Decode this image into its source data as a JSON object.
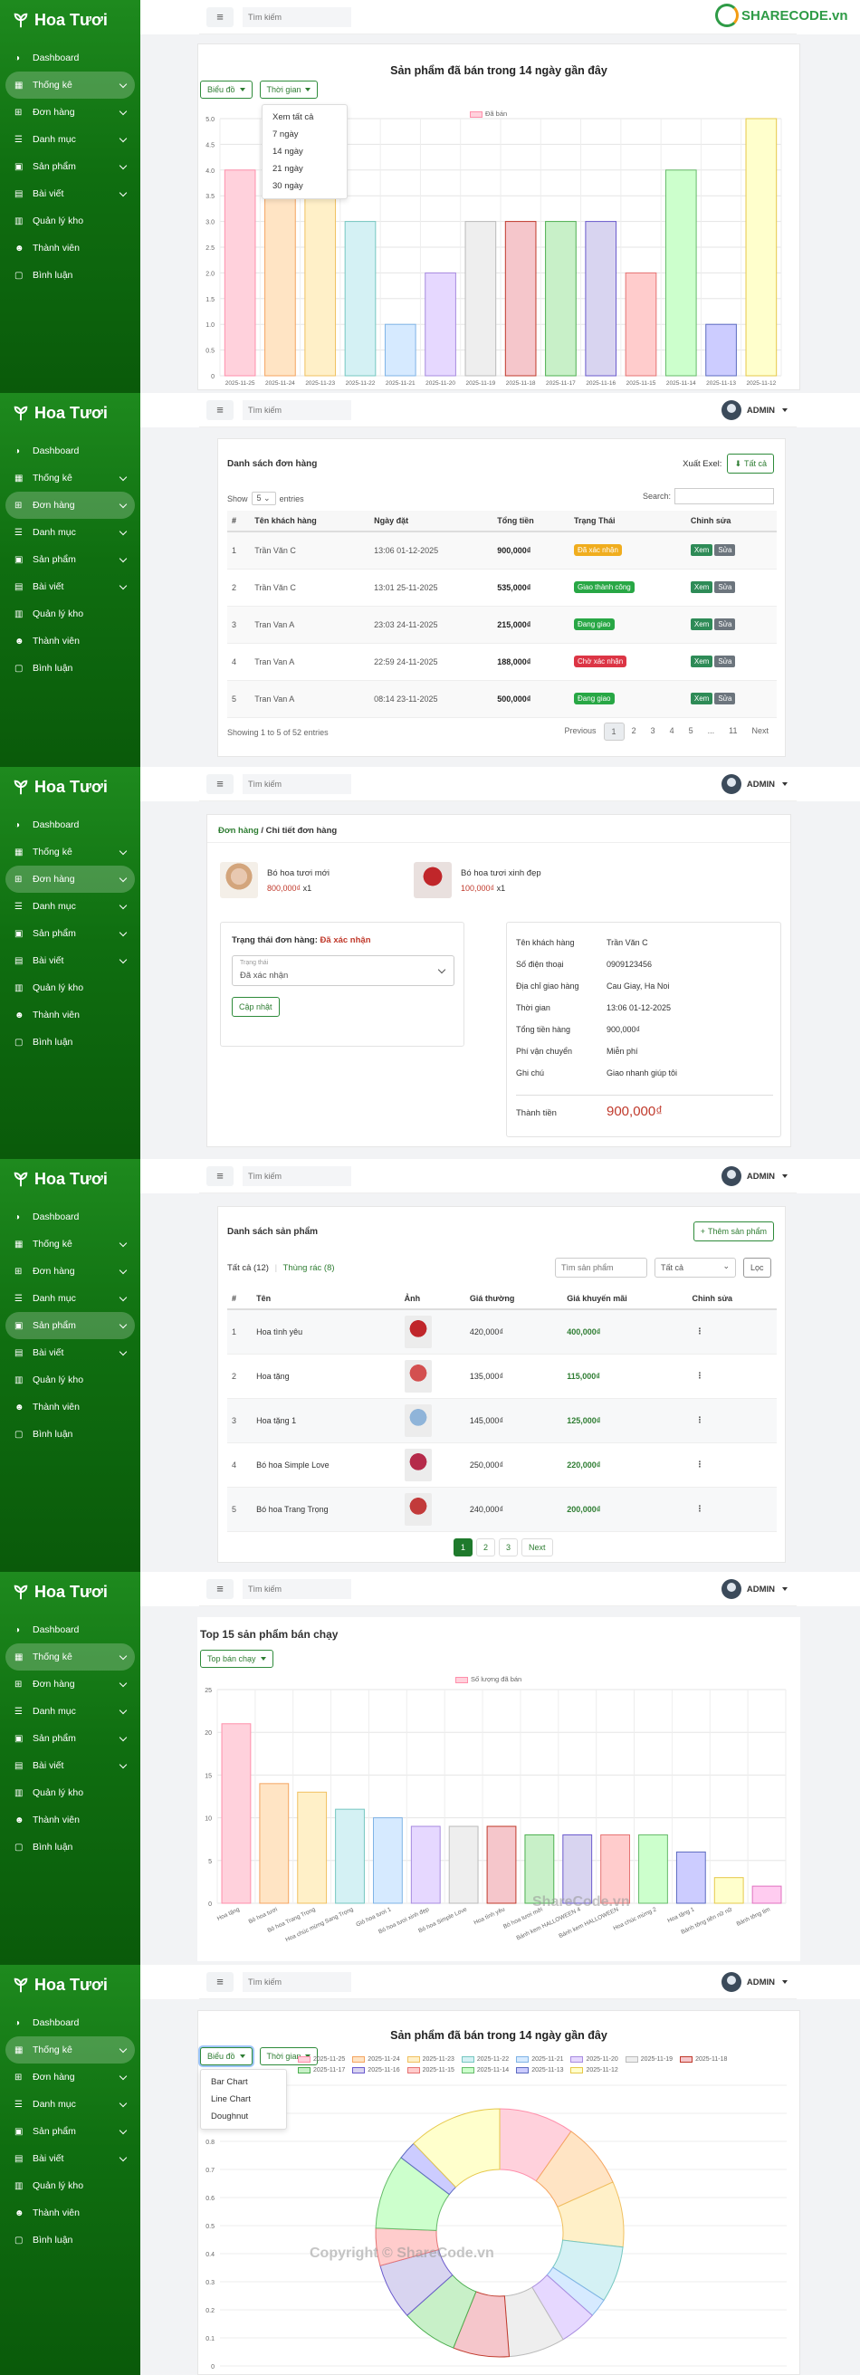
{
  "brand": "Hoa Tươi",
  "nav": [
    "Dashboard",
    "Thống kê",
    "Đơn hàng",
    "Danh mục",
    "Sản phẩm",
    "Bài viết",
    "Quản lý kho",
    "Thành viên",
    "Bình luận"
  ],
  "search_placeholder": "Tìm kiếm",
  "admin_label": "ADMIN",
  "sharecode_logo": "SHARECODE.vn",
  "watermark1": "ShareCode.vn",
  "watermark2": "Copyright © ShareCode.vn",
  "panel1": {
    "title": "Sản phẩm đã bán trong 14 ngày gần đây",
    "btn_chart": "Biểu đồ",
    "btn_time": "Thời gian",
    "time_options": [
      "Xem tất cả",
      "7 ngày",
      "14 ngày",
      "21 ngày",
      "30 ngày"
    ],
    "legend": "Đã bán"
  },
  "panel2": {
    "card_title": "Danh sách đơn hàng",
    "export_label": "Xuất Exel:",
    "export_btn": "Tất cả",
    "show_label": "Show",
    "show_value": "5",
    "entries_label": "entries",
    "search_label": "Search:",
    "columns": [
      "#",
      "Tên khách hàng",
      "Ngày đặt",
      "Tổng tiền",
      "Trạng Thái",
      "Chỉnh sửa"
    ],
    "rows": [
      {
        "id": "1",
        "name": "Trần Văn C",
        "date": "13:06 01-12-2025",
        "total": "900,000₫",
        "status": "Đã xác nhận",
        "color": "#f0ad1e"
      },
      {
        "id": "2",
        "name": "Trần Văn C",
        "date": "13:01 25-11-2025",
        "total": "535,000₫",
        "status": "Giao thành công",
        "color": "#28a745"
      },
      {
        "id": "3",
        "name": "Tran Van A",
        "date": "23:03 24-11-2025",
        "total": "215,000₫",
        "status": "Đang giao",
        "color": "#28a745"
      },
      {
        "id": "4",
        "name": "Tran Van A",
        "date": "22:59 24-11-2025",
        "total": "188,000₫",
        "status": "Chờ xác nhận",
        "color": "#dc3545"
      },
      {
        "id": "5",
        "name": "Tran Van A",
        "date": "08:14 23-11-2025",
        "total": "500,000₫",
        "status": "Đang giao",
        "color": "#28a745"
      }
    ],
    "btn_view": "Xem",
    "btn_edit": "Sửa",
    "info": "Showing 1 to 5 of 52 entries",
    "pages": [
      "Previous",
      "1",
      "2",
      "3",
      "4",
      "5",
      "...",
      "11",
      "Next"
    ]
  },
  "panel3": {
    "crumb_parent": "Đơn hàng",
    "crumb_current": "/ Chi tiết đơn hàng",
    "items": [
      {
        "name": "Bó hoa tươi mới",
        "price": "800,000₫",
        "qty": "x1"
      },
      {
        "name": "Bó hoa tươi xinh đẹp",
        "price": "100,000₫",
        "qty": "x1"
      }
    ],
    "status_label": "Trạng thái đơn hàng:",
    "status_value": "Đã xác nhận",
    "select_label": "Trạng thái",
    "select_value": "Đã xác nhận",
    "update_btn": "Cập nhật",
    "info": [
      {
        "k": "Tên khách hàng",
        "v": "Trần Văn C"
      },
      {
        "k": "Số điện thoại",
        "v": "0909123456"
      },
      {
        "k": "Địa chỉ giao hàng",
        "v": "Cau Giay, Ha Noi"
      },
      {
        "k": "Thời gian",
        "v": "13:06 01-12-2025"
      },
      {
        "k": "Tổng tiền hàng",
        "v": "900,000₫"
      },
      {
        "k": "Phí vận chuyển",
        "v": "Miễn phí"
      },
      {
        "k": "Ghi chú",
        "v": "Giao nhanh giúp tôi"
      }
    ],
    "total_label": "Thành tiền",
    "total_value": "900,000₫"
  },
  "panel4": {
    "card_title": "Danh sách sản phẩm",
    "add_btn": "Thêm sản phẩm",
    "tab_all": "Tất cả (12)",
    "tab_trash": "Thùng rác (8)",
    "search_placeholder": "Tìm sản phẩm",
    "filter_value": "Tất cả",
    "filter_btn": "Lọc",
    "columns": [
      "#",
      "Tên",
      "Ảnh",
      "Giá thường",
      "Giá khuyến mãi",
      "Chỉnh sửa"
    ],
    "rows": [
      {
        "id": "1",
        "name": "Hoa tình yêu",
        "price": "420,000₫",
        "sale": "400,000₫"
      },
      {
        "id": "2",
        "name": "Hoa tặng",
        "price": "135,000₫",
        "sale": "115,000₫"
      },
      {
        "id": "3",
        "name": "Hoa tặng 1",
        "price": "145,000₫",
        "sale": "125,000₫"
      },
      {
        "id": "4",
        "name": "Bó hoa Simple Love",
        "price": "250,000₫",
        "sale": "220,000₫"
      },
      {
        "id": "5",
        "name": "Bó hoa Trang Trọng",
        "price": "240,000₫",
        "sale": "200,000₫"
      }
    ],
    "pages": [
      "1",
      "2",
      "3",
      "Next"
    ]
  },
  "panel5": {
    "title": "Top 15 sản phẩm bán chạy",
    "btn": "Top bán chạy",
    "legend": "Số lượng đã bán"
  },
  "panel6": {
    "title": "Sản phẩm đã bán trong 14 ngày gần đây",
    "btn_chart": "Biểu đồ",
    "btn_time": "Thời gian",
    "chart_options": [
      "Bar Chart",
      "Line Chart",
      "Doughnut"
    ]
  },
  "chart_data": [
    {
      "type": "bar",
      "categories": [
        "2025-11-25",
        "2025-11-24",
        "2025-11-23",
        "2025-11-22",
        "2025-11-21",
        "2025-11-20",
        "2025-11-19",
        "2025-11-18",
        "2025-11-17",
        "2025-11-16",
        "2025-11-15",
        "2025-11-14",
        "2025-11-13",
        "2025-11-12"
      ],
      "series": [
        {
          "name": "Đã bán",
          "values": [
            4,
            3.5,
            3.5,
            3,
            1,
            2,
            3,
            3,
            3,
            3,
            2,
            4,
            1,
            5
          ]
        }
      ],
      "colors": [
        "#ffd1dc",
        "#ffe4c4",
        "#fff0c8",
        "#d4f1f4",
        "#d6eaff",
        "#e6d8ff",
        "#eeeeee",
        "#f5c6cb",
        "#c8f0c8",
        "#d8d4f0",
        "#ffcccc",
        "#ccffcc",
        "#ccccff",
        "#ffffcc"
      ],
      "borders": [
        "#ff8fab",
        "#f4a460",
        "#f0c060",
        "#76c7c0",
        "#7fb3e6",
        "#a78bdf",
        "#bbbbbb",
        "#c0392b",
        "#4caf50",
        "#6a5acd",
        "#e57373",
        "#66bb6a",
        "#5c6bc0",
        "#e6c84a"
      ],
      "yticks": [
        "0",
        "0.5",
        "1.0",
        "1.5",
        "2.0",
        "2.5",
        "3.0",
        "3.5",
        "4.0",
        "4.5",
        "5.0"
      ],
      "ylim": [
        0,
        5
      ]
    },
    {
      "type": "bar",
      "categories": [
        "Hoa tặng",
        "Bó hoa tươi",
        "Bó hoa Trang Trọng",
        "Hoa chúc mừng Sang Trọng",
        "Giỏ hoa tươi 1",
        "Bó hoa tươi xinh đẹp",
        "Bó hoa Simple Love",
        "Hoa tình yêu",
        "Bó hoa tươi mới",
        "Bánh kem HALLOWEEN 4",
        "Bánh kem HALLOWEEN",
        "Hoa chúc mừng 2",
        "Hoa tặng 1",
        "Bánh tông tiên nữ nữ",
        "Bánh tông tim"
      ],
      "series": [
        {
          "name": "Số lượng đã bán",
          "values": [
            21,
            14,
            13,
            11,
            10,
            9,
            9,
            9,
            8,
            8,
            8,
            8,
            6,
            3,
            2
          ]
        }
      ],
      "colors": [
        "#ffd1dc",
        "#ffe4c4",
        "#fff0c8",
        "#d4f1f4",
        "#d6eaff",
        "#e6d8ff",
        "#eeeeee",
        "#f5c6cb",
        "#c8f0c8",
        "#d8d4f0",
        "#ffcccc",
        "#ccffcc",
        "#ccccff",
        "#ffffcc",
        "#ffccf0"
      ],
      "borders": [
        "#ff8fab",
        "#f4a460",
        "#f0c060",
        "#76c7c0",
        "#7fb3e6",
        "#a78bdf",
        "#bbbbbb",
        "#c0392b",
        "#4caf50",
        "#6a5acd",
        "#e57373",
        "#66bb6a",
        "#5c6bc0",
        "#e6c84a",
        "#e070c0"
      ],
      "yticks": [
        "0",
        "5",
        "10",
        "15",
        "20",
        "25"
      ],
      "ylim": [
        0,
        25
      ]
    },
    {
      "type": "pie",
      "categories": [
        "2025-11-25",
        "2025-11-24",
        "2025-11-23",
        "2025-11-22",
        "2025-11-21",
        "2025-11-20",
        "2025-11-19",
        "2025-11-18",
        "2025-11-17",
        "2025-11-16",
        "2025-11-15",
        "2025-11-14",
        "2025-11-13",
        "2025-11-12"
      ],
      "values": [
        4,
        3.5,
        3.5,
        3,
        1,
        2,
        3,
        3,
        3,
        3,
        2,
        4,
        1,
        5
      ],
      "colors": [
        "#ffd1dc",
        "#ffe4c4",
        "#fff0c8",
        "#d4f1f4",
        "#d6eaff",
        "#e6d8ff",
        "#eeeeee",
        "#f5c6cb",
        "#c8f0c8",
        "#d8d4f0",
        "#ffcccc",
        "#ccffcc",
        "#ccccff",
        "#ffffcc"
      ],
      "borders": [
        "#ff8fab",
        "#f4a460",
        "#f0c060",
        "#76c7c0",
        "#7fb3e6",
        "#a78bdf",
        "#bbbbbb",
        "#c0392b",
        "#4caf50",
        "#6a5acd",
        "#e57373",
        "#66bb6a",
        "#5c6bc0",
        "#e6c84a"
      ],
      "yticks": [
        "0",
        "0.1",
        "0.2",
        "0.3",
        "0.4",
        "0.5",
        "0.6",
        "0.7",
        "0.8",
        "0.9",
        "1"
      ]
    }
  ]
}
